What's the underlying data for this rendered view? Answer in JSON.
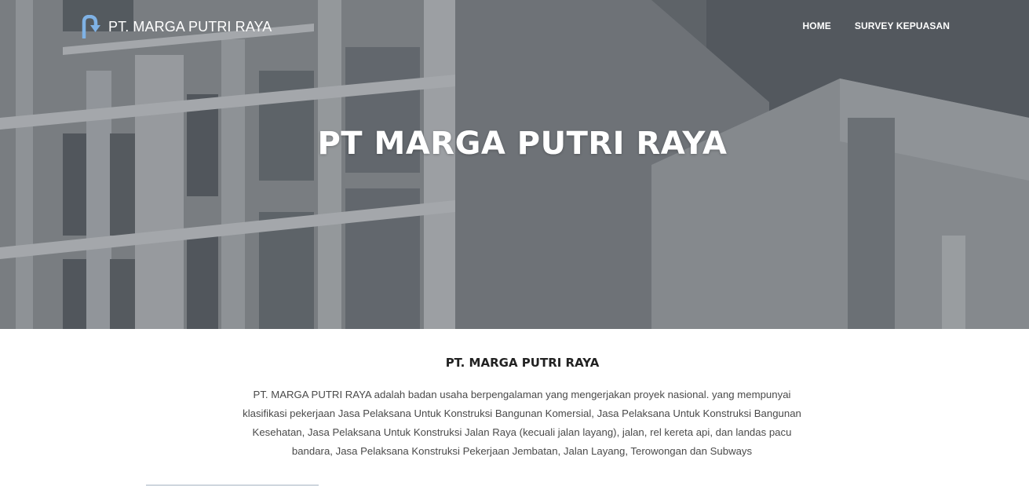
{
  "brand": {
    "name": "PT. MARGA PUTRI RAYA",
    "icon": "arrow-logo-icon",
    "icon_color": "#7fb2e5"
  },
  "nav": {
    "items": [
      {
        "label": "HOME"
      },
      {
        "label": "SURVEY KEPUASAN"
      }
    ]
  },
  "hero": {
    "title": "PT MARGA PUTRI RAYA"
  },
  "about": {
    "title": "PT. MARGA PUTRI RAYA",
    "text": "PT. MARGA PUTRI RAYA adalah badan usaha berpengalaman yang mengerjakan proyek nasional. yang mempunyai klasifikasi pekerjaan Jasa Pelaksana Untuk Konstruksi Bangunan Komersial, Jasa Pelaksana Untuk Konstruksi Bangunan Kesehatan, Jasa Pelaksana Untuk Konstruksi Jalan Raya (kecuali jalan layang), jalan, rel kereta api, dan landas pacu bandara, Jasa Pelaksana Konstruksi Pekerjaan Jembatan, Jalan Layang, Terowongan dan Subways"
  }
}
